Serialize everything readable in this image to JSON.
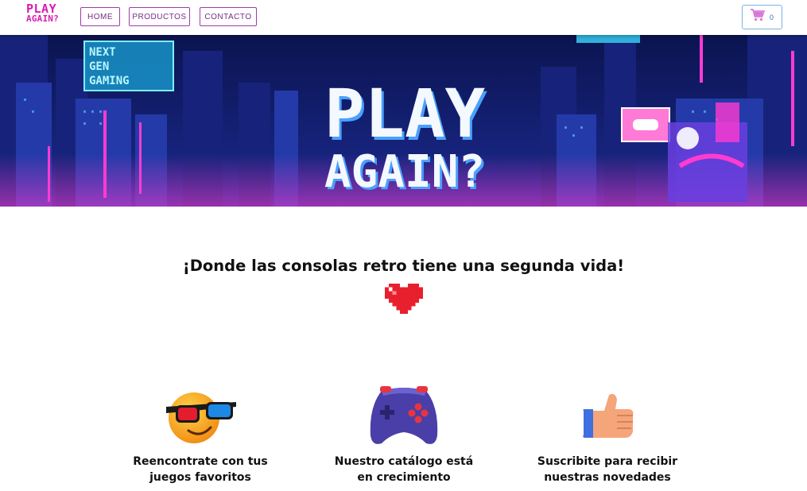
{
  "navbar": {
    "logo": {
      "line1": "PLAY",
      "line2": "AGAIN?"
    },
    "items": [
      {
        "label": "HOME"
      },
      {
        "label": "PRODUCTOS"
      },
      {
        "label": "CONTACTO"
      }
    ],
    "cart": {
      "icon": "cart-icon",
      "count": "0"
    }
  },
  "hero": {
    "title_line1": "PLAY",
    "title_line2": "AGAIN?",
    "sign_lines": [
      "NEXT",
      "GEN",
      "GAMING"
    ]
  },
  "main": {
    "tagline": "¡Donde las consolas retro tiene una segunda vida!",
    "heart_icon": "pixel-heart-icon"
  },
  "features": [
    {
      "icon": "sunglasses-emoji-icon",
      "line1": "Reencontrate con tus",
      "line2": "juegos favoritos"
    },
    {
      "icon": "gamepad-icon",
      "line1": "Nuestro catálogo está",
      "line2": "en crecimiento"
    },
    {
      "icon": "thumbs-up-icon",
      "line1": "Suscribite para recibir",
      "line2": "nuestras novedades"
    }
  ],
  "colors": {
    "brand": "#d81bb0",
    "nav_border": "#a03aa8",
    "cart_border": "#7ab4e6",
    "hero_bg": "#0f1d6b",
    "neon_pink": "#ff3bd1",
    "neon_cyan": "#39d8ff"
  }
}
